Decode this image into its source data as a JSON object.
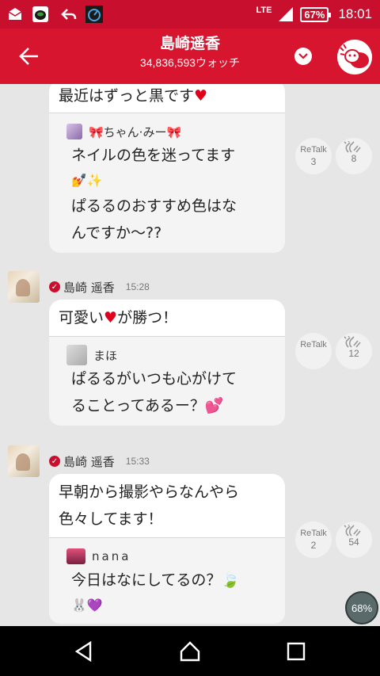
{
  "status_bar": {
    "network": "LTE",
    "battery": "67%",
    "time": "18:01",
    "icons": [
      "mail-icon",
      "shield-app-icon",
      "reply-arrow-icon",
      "speed-gauge-icon",
      "signal-icon"
    ]
  },
  "header": {
    "title": "島崎遥香",
    "subtitle": "34,836,593ウォッチ",
    "back_icon": "back-arrow-icon",
    "dropdown_icon": "chevron-down-icon"
  },
  "messages": [
    {
      "text_lines": [
        "最近はずっと黒です"
      ],
      "quote": {
        "user": "🎀ちゃん·みー🎀",
        "lines": [
          "ネイルの色を迷ってます",
          "💅✨",
          "ぱるるのおすすめ色はな",
          "んですか〜??"
        ]
      },
      "retalk": {
        "label": "ReTalk",
        "count": "3"
      },
      "clap_count": "8"
    },
    {
      "user": "島崎 遥香",
      "time": "15:28",
      "text_lines": [
        "可愛い",
        "が勝つ！"
      ],
      "quote": {
        "user": "まほ",
        "lines": [
          "ぱるるがいつも心がけて",
          "ることってあるー？💕"
        ]
      },
      "retalk": {
        "label": "ReTalk",
        "count": ""
      },
      "clap_count": "12"
    },
    {
      "user": "島崎 遥香",
      "time": "15:33",
      "text_lines": [
        "早朝から撮影やらなんやら",
        "色々してます！"
      ],
      "quote": {
        "user": "nana",
        "lines": [
          "今日はなにしてるの？🍃",
          "🐰💜"
        ]
      },
      "retalk": {
        "label": "ReTalk",
        "count": "2"
      },
      "clap_count": "54"
    }
  ],
  "badge": {
    "percent": "68%"
  },
  "nav": {
    "back": "nav-back-icon",
    "home": "nav-home-icon",
    "recents": "nav-recents-icon"
  }
}
